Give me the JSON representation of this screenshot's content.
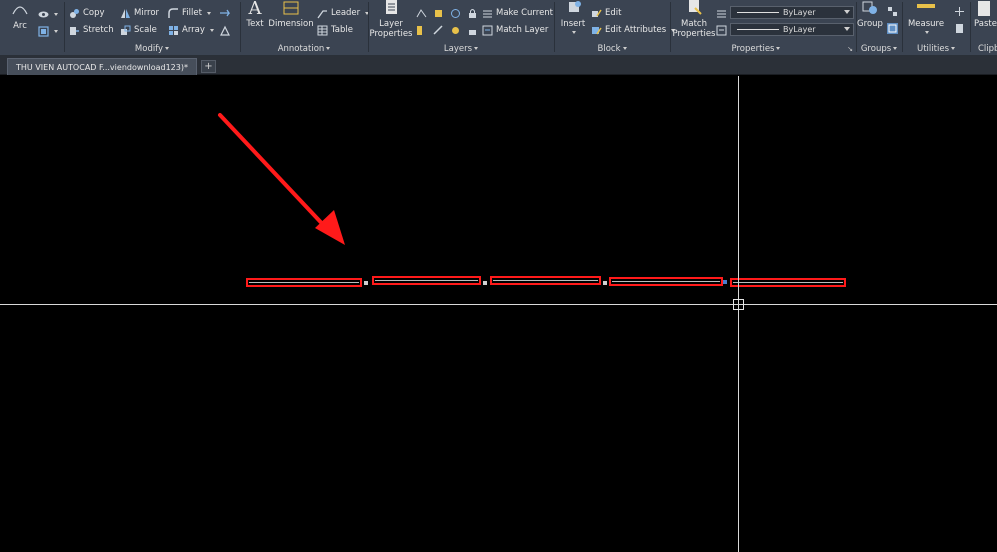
{
  "ribbon": {
    "draw": {
      "arc_label": "Arc"
    },
    "modify": {
      "title": "Modify",
      "copy": "Copy",
      "mirror": "Mirror",
      "fillet": "Fillet",
      "stretch": "Stretch",
      "scale": "Scale",
      "array": "Array"
    },
    "annotation": {
      "title": "Annotation",
      "text": "Text",
      "dimension": "Dimension",
      "leader": "Leader",
      "table": "Table"
    },
    "layers": {
      "title": "Layers",
      "layer_properties_line1": "Layer",
      "layer_properties_line2": "Properties",
      "make_current": "Make Current",
      "match_layer": "Match Layer"
    },
    "block": {
      "title": "Block",
      "insert": "Insert",
      "edit": "Edit",
      "edit_attributes": "Edit Attributes"
    },
    "properties": {
      "title": "Properties",
      "match_line1": "Match",
      "match_line2": "Properties",
      "linetype_value": "ByLayer",
      "lineweight_value": "ByLayer"
    },
    "groups": {
      "title": "Groups",
      "group": "Group"
    },
    "utilities": {
      "title": "Utilities",
      "measure": "Measure"
    },
    "clipboard": {
      "title": "Clipb",
      "paste": "Paste"
    }
  },
  "tabs": {
    "document": "THU VIEN AUTOCAD F...viendownload123)*",
    "new_tab": "+"
  },
  "colors": {
    "ribbon_bg": "#3b4452",
    "canvas_bg": "#000000",
    "selection_highlight": "#ff1a1a",
    "annotation_arrow": "#ff1a1a",
    "crosshair": "#d9d9d9"
  }
}
